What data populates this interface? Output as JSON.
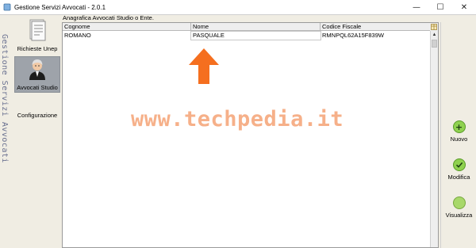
{
  "window": {
    "title": "Gestione Servizi Avvocati - 2.0.1",
    "controls": {
      "minimize": "—",
      "maximize": "☐",
      "close": "✕"
    }
  },
  "sidebar": {
    "vertical_title": "Gestione Servizi Avvocati",
    "items": [
      {
        "label": "Richieste Unep",
        "icon": "document-icon",
        "active": false
      },
      {
        "label": "Avvocati Studio",
        "icon": "lawyer-avatar-icon",
        "active": true
      },
      {
        "label": "Configurazione",
        "icon": "",
        "active": false
      }
    ]
  },
  "panel": {
    "title": "Anagrafica Avvocati Studio o Ente.",
    "columns": [
      "Cognome",
      "Nome",
      "Codice Fiscale"
    ],
    "rows": [
      [
        "ROMANO",
        "PASQUALE",
        "RMNPQL62A15F839W"
      ]
    ]
  },
  "actions": [
    {
      "label": "Nuovo",
      "icon": "plus-icon"
    },
    {
      "label": "Modifica",
      "icon": "check-icon"
    },
    {
      "label": "Visualizza",
      "icon": "view-icon"
    }
  ],
  "overlay": {
    "watermark": "www.techpedia.it",
    "annotation_arrow_color": "#f56f1f"
  },
  "colors": {
    "frame_bg": "#f0ede3",
    "active_item_bg": "#9ea3aa",
    "accent_green": "#8fd14f"
  }
}
